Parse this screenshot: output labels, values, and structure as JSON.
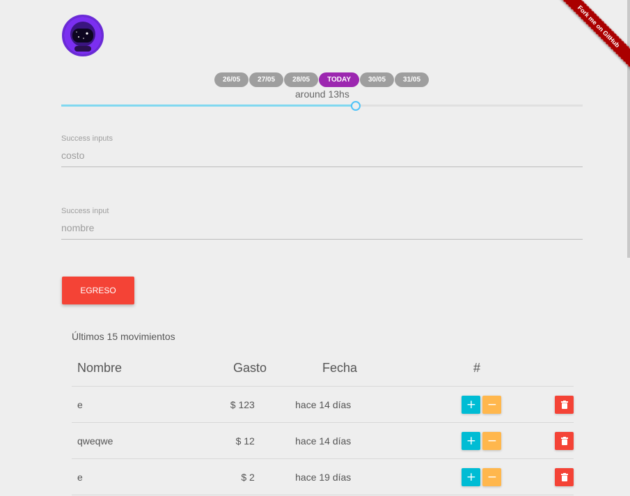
{
  "ribbon": {
    "text": "Fork me on GitHub"
  },
  "dates": {
    "items": [
      {
        "label": "26/05",
        "active": false
      },
      {
        "label": "27/05",
        "active": false
      },
      {
        "label": "28/05",
        "active": false
      },
      {
        "label": "TODAY",
        "active": true
      },
      {
        "label": "30/05",
        "active": false
      },
      {
        "label": "31/05",
        "active": false
      }
    ],
    "time_label": "around 13hs"
  },
  "slider": {
    "value": 0.565
  },
  "form": {
    "costo": {
      "label": "Success inputs",
      "placeholder": "costo",
      "value": ""
    },
    "nombre": {
      "label": "Success input",
      "placeholder": "nombre",
      "value": ""
    },
    "submit_label": "EGRESO"
  },
  "table": {
    "title": "Últimos 15 movimientos",
    "headers": {
      "nombre": "Nombre",
      "gasto": "Gasto",
      "fecha": "Fecha",
      "hash": "#"
    },
    "rows": [
      {
        "nombre": "e",
        "gasto": "$ 123",
        "fecha": "hace 14 días"
      },
      {
        "nombre": "qweqwe",
        "gasto": "$ 12",
        "fecha": "hace 14 días"
      },
      {
        "nombre": "e",
        "gasto": "$ 2",
        "fecha": "hace 19 días"
      }
    ],
    "action_icons": {
      "plus": "+",
      "minus": "−"
    }
  },
  "colors": {
    "accent_purple": "#9c27b0",
    "chip_grey": "#9e9e9e",
    "danger": "#f44336",
    "plus": "#00bcd4",
    "minus": "#ffb74d",
    "slider": "#4fc3f7"
  }
}
